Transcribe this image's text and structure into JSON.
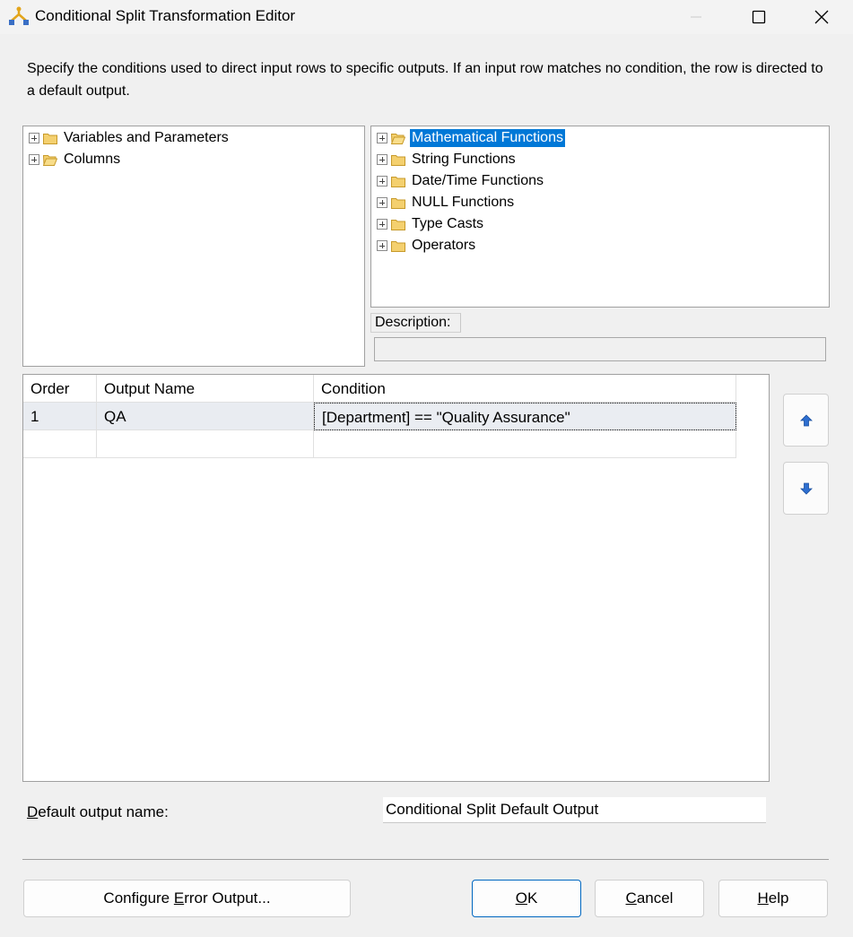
{
  "window": {
    "title": "Conditional Split Transformation Editor"
  },
  "intro_text": "Specify the conditions used to direct input rows to specific outputs. If an input row matches no condition, the row is directed to a default output.",
  "left_tree": [
    {
      "label": "Variables and Parameters"
    },
    {
      "label": "Columns"
    }
  ],
  "right_tree": [
    {
      "label": "Mathematical Functions",
      "selected": true
    },
    {
      "label": "String Functions"
    },
    {
      "label": "Date/Time Functions"
    },
    {
      "label": "NULL Functions"
    },
    {
      "label": "Type Casts"
    },
    {
      "label": "Operators"
    }
  ],
  "description": {
    "label": "Description:",
    "value": ""
  },
  "grid": {
    "columns": [
      "Order",
      "Output Name",
      "Condition"
    ],
    "rows": [
      {
        "order": "1",
        "output_name": "QA",
        "condition": "[Department] == \"Quality Assurance\""
      }
    ]
  },
  "default_output": {
    "label_mnemonic": "D",
    "label_rest": "efault output name:",
    "value": "Conditional Split Default Output"
  },
  "buttons": {
    "config_pre": "Configure ",
    "config_mnemonic": "E",
    "config_post": "rror Output...",
    "ok_mnemonic": "O",
    "ok_rest": "K",
    "cancel_mnemonic": "C",
    "cancel_rest": "ancel",
    "help_mnemonic": "H",
    "help_rest": "elp"
  },
  "colors": {
    "selection": "#0078d7",
    "arrow_icon": "#2e6fd0",
    "folder": "#e8c15a"
  }
}
